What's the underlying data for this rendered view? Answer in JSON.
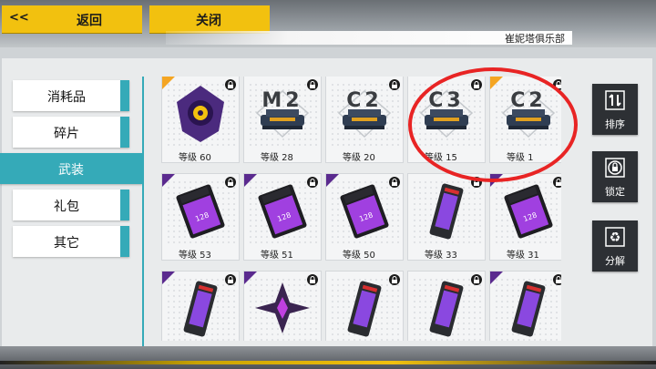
{
  "header": {
    "back_chevron": "<<",
    "back_label": "返回",
    "close_label": "关闭",
    "club_name": "崔妮塔俱乐部"
  },
  "nav": {
    "items": [
      {
        "label": "消耗品",
        "active": false
      },
      {
        "label": "碎片",
        "active": false
      },
      {
        "label": "武装",
        "active": true
      },
      {
        "label": "礼包",
        "active": false
      },
      {
        "label": "其它",
        "active": false
      }
    ]
  },
  "items": [
    {
      "level": "等级 60",
      "art": "purple-orb-icon",
      "rarity": "orange"
    },
    {
      "level": "等级 28",
      "art": "module-icon",
      "code": "M2",
      "rarity": "none"
    },
    {
      "level": "等级 20",
      "art": "module-icon",
      "code": "C2",
      "rarity": "none"
    },
    {
      "level": "等级 15",
      "art": "module-icon",
      "code": "C3",
      "rarity": "none"
    },
    {
      "level": "等级 1",
      "art": "module-icon",
      "code": "C2",
      "rarity": "orange"
    },
    {
      "level": "等级 53",
      "art": "memory-card-icon",
      "rarity": "purple"
    },
    {
      "level": "等级 51",
      "art": "memory-card-icon",
      "rarity": "purple"
    },
    {
      "level": "等级 50",
      "art": "memory-card-icon",
      "rarity": "purple"
    },
    {
      "level": "等级 33",
      "art": "battery-icon",
      "rarity": "none"
    },
    {
      "level": "等级 31",
      "art": "memory-card-icon",
      "rarity": "purple"
    },
    {
      "level": "",
      "art": "battery-icon",
      "rarity": "purple"
    },
    {
      "level": "",
      "art": "crystal-star-icon",
      "rarity": "purple"
    },
    {
      "level": "",
      "art": "battery-icon",
      "rarity": "none"
    },
    {
      "level": "",
      "art": "battery-icon",
      "rarity": "none"
    },
    {
      "level": "",
      "art": "battery-icon",
      "rarity": "purple"
    }
  ],
  "right_panel": {
    "sort_label": "排序",
    "lock_label": "锁定",
    "recycle_label": "分解"
  },
  "colors": {
    "accent_teal": "#35aab8",
    "button_yellow": "#f2c10f",
    "annotation_red": "#e82424",
    "rarity_orange": "#f4a522",
    "rarity_purple": "#5a2a8e"
  }
}
